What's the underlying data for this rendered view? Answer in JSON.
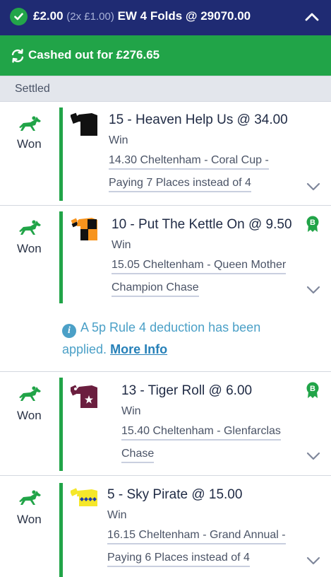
{
  "header": {
    "stake": "£2.00",
    "stake_detail": "(2x £1.00)",
    "bet_type": "EW 4 Folds @ 29070.00"
  },
  "cashout": {
    "text": "Cashed out for £276.65"
  },
  "section": {
    "label": "Settled"
  },
  "selections": [
    {
      "result": "Won",
      "title": "15 - Heaven Help Us @ 34.00",
      "market": "Win",
      "race_line1": "14.30 Cheltenham - Coral Cup -",
      "race_line2": "Paying 7 Places instead of 4",
      "silk_icon": "black-silk-icon",
      "has_boost": false
    },
    {
      "result": "Won",
      "title": "10 - Put The Kettle On @ 9.50",
      "market": "Win",
      "race_line1": "15.05 Cheltenham - Queen Mother",
      "race_line2": "Champion Chase",
      "silk_icon": "orange-black-check-silk-icon",
      "has_boost": true,
      "boost_label": "B",
      "notice_text": "A 5p Rule 4 deduction has been applied.",
      "notice_link": "More Info"
    },
    {
      "result": "Won",
      "title": "13 - Tiger Roll @ 6.00",
      "market": "Win",
      "race_line1": "15.40 Cheltenham - Glenfarclas",
      "race_line2": "Chase",
      "silk_icon": "maroon-star-silk-icon",
      "has_boost": true,
      "boost_label": "B"
    },
    {
      "result": "Won",
      "title": "5 - Sky Pirate @ 15.00",
      "market": "Win",
      "race_line1": "16.15 Cheltenham - Grand Annual -",
      "race_line2": "Paying 6 Places instead of 4",
      "silk_icon": "yellow-blue-diamonds-silk-icon",
      "has_boost": false
    }
  ],
  "colors": {
    "header_bg": "#1f2b73",
    "success_green": "#21a448",
    "settled_bg": "#e3e6ec",
    "info_blue": "#4ba0c7"
  }
}
